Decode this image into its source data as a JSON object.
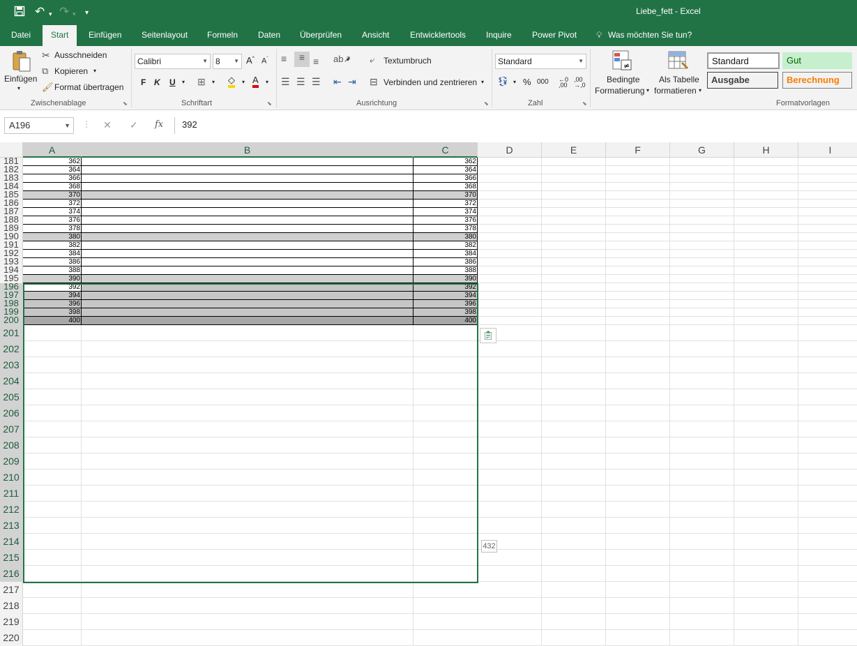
{
  "titlebar": {
    "doc_title": "Liebe_fett  -  Excel",
    "save_icon": "save-icon",
    "undo_icon": "undo-icon",
    "redo_icon": "redo-icon",
    "customize_icon": "customize-qat-icon"
  },
  "tabs": [
    "Datei",
    "Start",
    "Einfügen",
    "Seitenlayout",
    "Formeln",
    "Daten",
    "Überprüfen",
    "Ansicht",
    "Entwicklertools",
    "Inquire",
    "Power Pivot"
  ],
  "tell_me": "Was möchten Sie tun?",
  "ribbon": {
    "clipboard": {
      "paste": "Einfügen",
      "cut": "Ausschneiden",
      "copy": "Kopieren",
      "format_painter": "Format übertragen",
      "label": "Zwischenablage"
    },
    "font": {
      "name": "Calibri",
      "size": "8",
      "bold": "F",
      "italic": "K",
      "underline": "U",
      "label": "Schriftart"
    },
    "alignment": {
      "wrap": "Textumbruch",
      "merge": "Verbinden und zentrieren",
      "label": "Ausrichtung"
    },
    "number": {
      "format": "Standard",
      "percent": "%",
      "thousands": "000",
      "label": "Zahl"
    },
    "cond_format": {
      "line1": "Bedingte",
      "line2": "Formatierung"
    },
    "as_table": {
      "line1": "Als Tabelle",
      "line2": "formatieren"
    },
    "styles": {
      "standard": "Standard",
      "gut": "Gut",
      "ausgabe": "Ausgabe",
      "berechnung": "Berechnung",
      "label": "Formatvorlagen"
    }
  },
  "formula_bar": {
    "name_box": "A196",
    "cancel": "✕",
    "enter": "✓",
    "fx": "fx",
    "value": "392"
  },
  "columns": [
    "A",
    "B",
    "C",
    "D",
    "E",
    "F",
    "G",
    "H",
    "I"
  ],
  "small_rows": [
    {
      "num": "181",
      "a": "362",
      "c": "362",
      "shaded": false
    },
    {
      "num": "182",
      "a": "364",
      "c": "364",
      "shaded": false
    },
    {
      "num": "183",
      "a": "366",
      "c": "366",
      "shaded": false
    },
    {
      "num": "184",
      "a": "368",
      "c": "368",
      "shaded": false
    },
    {
      "num": "185",
      "a": "370",
      "c": "370",
      "shaded": true
    },
    {
      "num": "186",
      "a": "372",
      "c": "372",
      "shaded": false
    },
    {
      "num": "187",
      "a": "374",
      "c": "374",
      "shaded": false
    },
    {
      "num": "188",
      "a": "376",
      "c": "376",
      "shaded": false
    },
    {
      "num": "189",
      "a": "378",
      "c": "378",
      "shaded": false
    },
    {
      "num": "190",
      "a": "380",
      "c": "380",
      "shaded": true
    },
    {
      "num": "191",
      "a": "382",
      "c": "382",
      "shaded": false
    },
    {
      "num": "192",
      "a": "384",
      "c": "384",
      "shaded": false
    },
    {
      "num": "193",
      "a": "386",
      "c": "386",
      "shaded": false
    },
    {
      "num": "194",
      "a": "388",
      "c": "388",
      "shaded": false
    },
    {
      "num": "195",
      "a": "390",
      "c": "390",
      "shaded": true
    },
    {
      "num": "196",
      "a": "392",
      "c": "392",
      "shaded": false
    },
    {
      "num": "197",
      "a": "394",
      "c": "394",
      "shaded": false
    },
    {
      "num": "198",
      "a": "396",
      "c": "396",
      "shaded": false
    },
    {
      "num": "199",
      "a": "398",
      "c": "398",
      "shaded": false
    },
    {
      "num": "200",
      "a": "400",
      "c": "400",
      "shaded": true
    }
  ],
  "big_rows": [
    "201",
    "202",
    "203",
    "204",
    "205",
    "206",
    "207",
    "208",
    "209",
    "210",
    "211",
    "212",
    "213",
    "214",
    "215",
    "216",
    "217",
    "218",
    "219",
    "220"
  ],
  "paste_options_icon": "paste-options-icon",
  "count_tooltip": "432"
}
